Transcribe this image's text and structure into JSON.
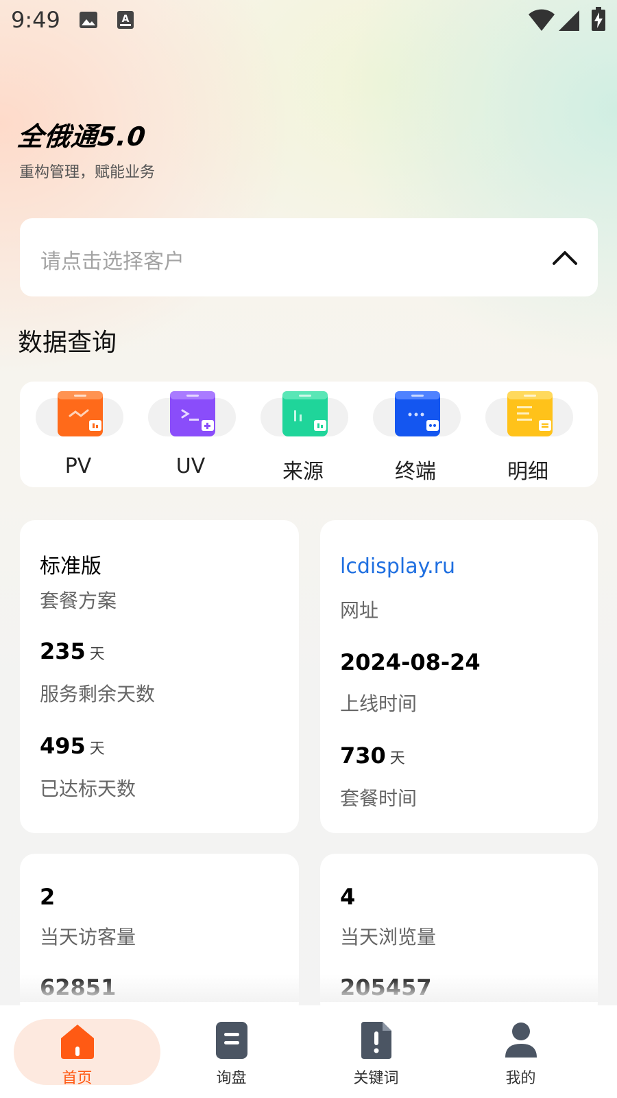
{
  "status_bar": {
    "time": "9:49",
    "a_badge": "A"
  },
  "header": {
    "brand": "全俄通5.0",
    "slogan": "重构管理，赋能业务"
  },
  "customer_select": {
    "placeholder": "请点击选择客户"
  },
  "section_title": "数据查询",
  "quick_actions": [
    {
      "label": "PV",
      "color": "#ff6a1a"
    },
    {
      "label": "UV",
      "color": "#8a4dfa"
    },
    {
      "label": "来源",
      "color": "#1fd59a"
    },
    {
      "label": "终端",
      "color": "#1456f0"
    },
    {
      "label": "明细",
      "color": "#ffc21a"
    }
  ],
  "cards": {
    "plan": {
      "title": "标准版",
      "title_label": "套餐方案",
      "remaining_days": "235",
      "remaining_unit": "天",
      "remaining_label": "服务剩余天数",
      "achieved_days": "495",
      "achieved_unit": "天",
      "achieved_label": "已达标天数"
    },
    "site": {
      "url": "lcdisplay.ru",
      "url_label": "网址",
      "online_date": "2024-08-24",
      "online_label": "上线时间",
      "plan_days": "730",
      "plan_unit": "天",
      "plan_label": "套餐时间"
    },
    "visitors": {
      "today": "2",
      "today_label": "当天访客量",
      "total": "62851"
    },
    "views": {
      "today": "4",
      "today_label": "当天浏览量",
      "total": "205457"
    }
  },
  "tabs": [
    {
      "label": "首页",
      "active": true
    },
    {
      "label": "询盘",
      "active": false
    },
    {
      "label": "关键词",
      "active": false
    },
    {
      "label": "我的",
      "active": false
    }
  ],
  "colors": {
    "accent": "#ff5a14",
    "link": "#1f6fe0",
    "tab_icon": "#4b5563"
  }
}
